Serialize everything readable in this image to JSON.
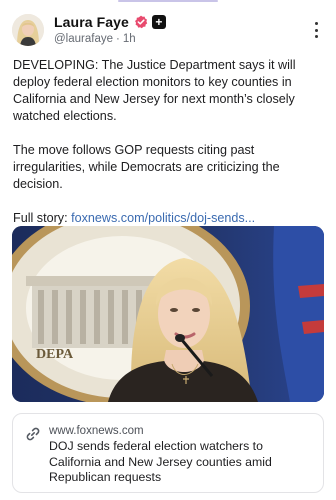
{
  "post": {
    "author": {
      "display_name": "Laura Faye",
      "handle": "@laurafaye",
      "separator": "·",
      "time_ago": "1h"
    },
    "body": {
      "paragraph_1": "DEVELOPING: The Justice Department says it will deploy federal election monitors to key counties in California and New Jersey for next month’s closely watched elections.",
      "paragraph_2": "The move follows GOP requests citing past irregularities, while Democrats are criticizing the decision.",
      "story_prefix": "Full story: ",
      "story_link": "foxnews.com/politics/doj-sends..."
    },
    "link_card": {
      "domain": "www.foxnews.com",
      "headline": "DOJ sends federal election watchers to California and New Jersey counties amid Republican requests"
    }
  },
  "icons": {
    "verified": "verified-badge-icon",
    "plus": "plus-icon",
    "more": "more-vertical-icon",
    "link": "link-chain-icon"
  },
  "colors": {
    "verified_badge": "#e84a6e",
    "link": "#3a6ab0",
    "text": "#1d1d1f",
    "muted": "#666b73"
  }
}
